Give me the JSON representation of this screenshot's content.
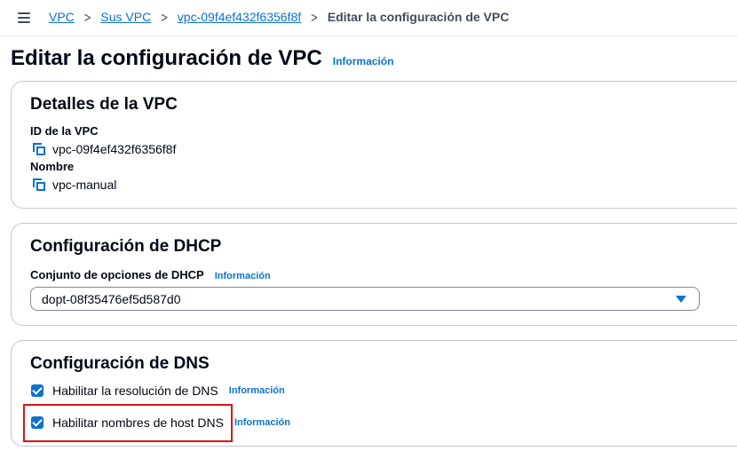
{
  "breadcrumbs": {
    "items": [
      "VPC",
      "Sus VPC",
      "vpc-09f4ef432f6356f8f"
    ],
    "separator": ">",
    "current": "Editar la configuración de VPC"
  },
  "page": {
    "title": "Editar la configuración de VPC",
    "info_label": "Información"
  },
  "vpc_details": {
    "title": "Detalles de la VPC",
    "id_label": "ID de la VPC",
    "id_value": "vpc-09f4ef432f6356f8f",
    "name_label": "Nombre",
    "name_value": "vpc-manual"
  },
  "dhcp": {
    "title": "Configuración de DHCP",
    "field_label": "Conjunto de opciones de DHCP",
    "info_label": "Información",
    "selected_value": "dopt-08f35476ef5d587d0"
  },
  "dns": {
    "title": "Configuración de DNS",
    "options": [
      {
        "label": "Habilitar la resolución de DNS",
        "checked": true,
        "info_label": "Información"
      },
      {
        "label": "Habilitar nombres de host DNS",
        "checked": true,
        "info_label": "Información"
      }
    ]
  },
  "colors": {
    "accent": "#0972d3",
    "highlight": "#d91515",
    "text": "#000716"
  }
}
